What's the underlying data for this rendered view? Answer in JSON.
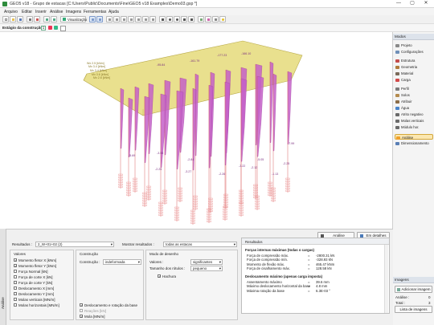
{
  "window": {
    "title": "GEO5 v18 - Grupo de estacas [C:\\Users\\Public\\Documents\\Fine\\GEO5 v18 Examples\\Demo03.gsp *]",
    "minimize": "—",
    "maximize": "▢",
    "close": "✕"
  },
  "menu": [
    "Arquivo",
    "Editar",
    "Inserir",
    "Análise",
    "Imagens",
    "Ferramentas",
    "Ajuda"
  ],
  "toolbar": {
    "visualization_label": "Visualização"
  },
  "stage": {
    "label": "Estágio da construção :",
    "current": "1"
  },
  "plot": {
    "value_labels": [
      "Mx 3.4 [kNm]",
      "Mx 3.4 [kNm]",
      "Mx 3.6 [kNm]",
      "Mx 2.6 [kNm]",
      "Wx 2.5 [kNm]",
      "-95.84",
      "-161.79",
      "-177.23",
      "-166.10",
      "-5.69",
      "-2.25",
      "-3.27",
      "-2.26",
      "-3.22",
      "-5.05",
      "-2.25",
      "-1.13",
      "-2.84",
      "-2.12",
      "-3.55",
      "-7.99"
    ]
  },
  "right_panel": {
    "modes_header": "Modos",
    "items": [
      {
        "label": "Projeto",
        "color": "#8a8a8a"
      },
      {
        "label": "Configurações",
        "color": "#6f8fb8"
      },
      {
        "label": "Estrutura",
        "color": "#c44c4c"
      },
      {
        "label": "Geometria",
        "color": "#b07a3b"
      },
      {
        "label": "Material",
        "color": "#7a6a5a"
      },
      {
        "label": "Carga",
        "color": "#d24a4a"
      },
      {
        "label": "Perfil",
        "color": "#7b7b7b"
      },
      {
        "label": "Solos",
        "color": "#b58c4f"
      },
      {
        "label": "Atribuir",
        "color": "#8c6d48"
      },
      {
        "label": "Água",
        "color": "#4a84c9"
      },
      {
        "label": "Atrito negativo",
        "color": "#6a6a6a"
      },
      {
        "label": "Molas verticais",
        "color": "#6a6a6a"
      },
      {
        "label": "Módulo hor.",
        "color": "#6a6a6a"
      },
      {
        "label": "Análise",
        "color": "#f0a02a"
      },
      {
        "label": "Dimensionamento",
        "color": "#5a7fb5"
      }
    ],
    "images_header": "Imagens",
    "add_image": "Adicionar imagem",
    "analysis_label": "Análise :",
    "analysis_count": "0",
    "total_label": "Total :",
    "total_count": "3",
    "image_list": "Lista de imagens"
  },
  "bottom": {
    "side_tab": "Análise",
    "analyze_button": "Análise",
    "details_button": "Em detalhes",
    "results_label": "Resultados :",
    "results_value": "2_W+01+02 (2)",
    "show_results_label": "Mostrar resultados :",
    "show_results_value": "todas as estacas",
    "values_title": "Valores",
    "values": [
      {
        "label": "Momento fletor X [kNm]",
        "checked": true
      },
      {
        "label": "Momento fletor Y [kNm]",
        "checked": true
      },
      {
        "label": "Força Normal [kN]",
        "checked": false
      },
      {
        "label": "Força de corte X [kN]",
        "checked": false
      },
      {
        "label": "Força de corte Y [kN]",
        "checked": false
      },
      {
        "label": "Deslocamento X [mm]",
        "checked": false
      },
      {
        "label": "Deslocamento Y [mm]",
        "checked": false
      },
      {
        "label": "Molas verticais [MN/m]",
        "checked": false
      },
      {
        "label": "Molas horizontais [MN/m]",
        "checked": false
      }
    ],
    "construction_title": "Construção",
    "construction_label": "Construção :",
    "construction_value": "indeformada",
    "construction_checks": [
      {
        "label": "Deslocamento e rotação da base",
        "checked": true
      },
      {
        "label": "Reações [kN]",
        "checked": false
      },
      {
        "label": "Mola [MN/m]",
        "checked": true
      }
    ],
    "draw_title": "Modo de desenho",
    "draw_values_label": "Valores :",
    "draw_values_value": "significantes",
    "label_size_label": "Tamanho dos rótulos :",
    "label_size_value": "pequeno",
    "hatching_label": "Hachura",
    "hatching_checked": true
  },
  "results": {
    "header": "Resultados",
    "section1_title": "Forças internas máximas (todas o cargas)",
    "section1": [
      {
        "label": "Força de compressão máx.",
        "eq": "=",
        "value": "-2800.31 kN"
      },
      {
        "label": "Força de compressão mín.",
        "eq": "=",
        "value": "-328.93 kN"
      },
      {
        "label": "Momento de flexão máx.",
        "eq": "=",
        "value": "465.47 kNm"
      },
      {
        "label": "Força de cisalhamento máx.",
        "eq": "=",
        "value": "128.58 kN"
      }
    ],
    "section2_title": "Deslocamento máximo (apenas carga imposta)",
    "section2": [
      {
        "label": "Assentamento máximo",
        "eq": "=",
        "value": "39.6 mm"
      },
      {
        "label": "Máximo deslocamento horizontal da base",
        "eq": "=",
        "value": "4.8 mm"
      },
      {
        "label": "Máxima rotação da base",
        "eq": "=",
        "value": "6.3E-03 °"
      }
    ]
  }
}
